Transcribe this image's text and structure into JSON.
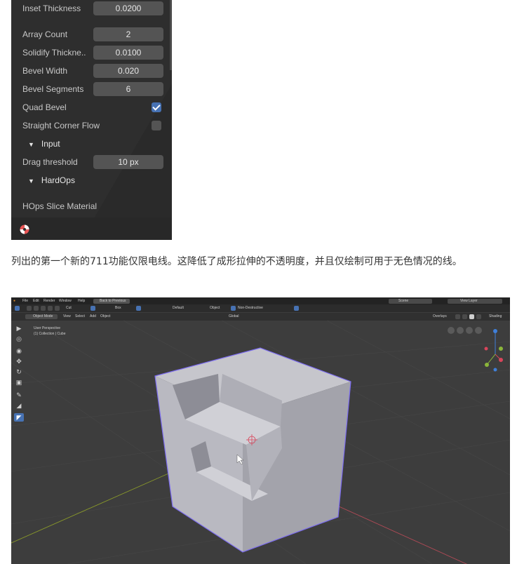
{
  "prefs": {
    "rows": [
      {
        "label": "Inset Thickness",
        "value": "0.0200"
      },
      {
        "label": "Array Count",
        "value": "2"
      },
      {
        "label": "Solidify Thickne..",
        "value": "0.0100"
      },
      {
        "label": "Bevel Width",
        "value": "0.020"
      },
      {
        "label": "Bevel Segments",
        "value": "6"
      },
      {
        "label": "Quad Bevel",
        "checked": true
      },
      {
        "label": "Straight Corner Flow",
        "checked": false
      },
      {
        "section": "Input"
      },
      {
        "label": "Drag threshold",
        "value": "10 px"
      },
      {
        "section": "HardOps"
      },
      {
        "label": "HOps Slice Material"
      }
    ],
    "icon": "blender-material-icon"
  },
  "caption": "列出的第一个新的711功能仅限电线。这降低了成形拉伸的不透明度，并且仅绘制可用于无色情况的线。",
  "blender": {
    "menu": [
      "File",
      "Edit",
      "Render",
      "Window",
      "Help"
    ],
    "back_button": "Back to Previous",
    "scene": "Scene",
    "view_layer": "View Layer",
    "toolbar": {
      "cut": "Cut",
      "box": "Box",
      "default": "Default",
      "object": "Object",
      "non_destructive": "Non-Destructive"
    },
    "header": {
      "mode": "Object Mode",
      "menus": [
        "View",
        "Select",
        "Add",
        "Object"
      ],
      "orientation": "Global",
      "overlays": "Overlays",
      "shading": "Shading"
    },
    "viewport": {
      "perspective": "User Perspective",
      "collection": "(1) Collection | Cube"
    },
    "colors": {
      "accent": "#4772b3",
      "cube": "#b9b9c1",
      "outline": "#7c6cf0",
      "axis_x": "#d9455b",
      "axis_y": "#8bb63a",
      "axis_z": "#3f7fd9"
    }
  }
}
